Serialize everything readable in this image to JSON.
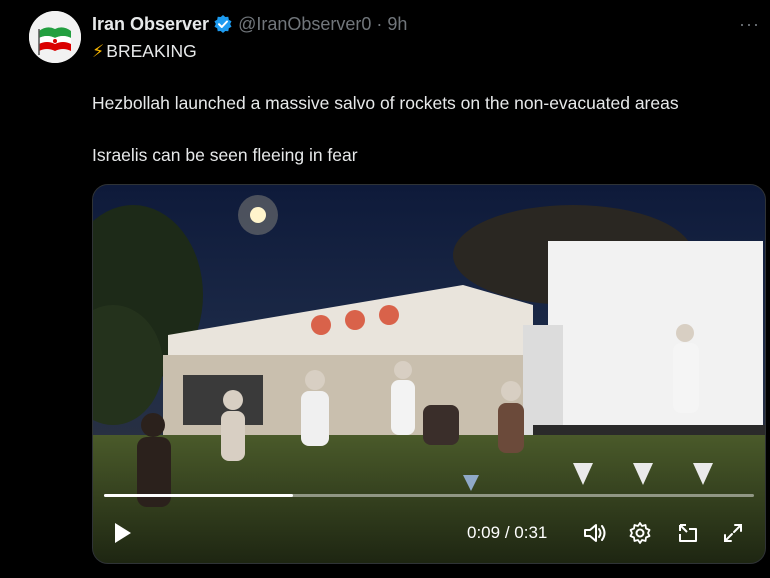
{
  "tweet": {
    "display_name": "Iran Observer",
    "handle": "@IranObserver0",
    "separator": "·",
    "time": "9h",
    "more": "···",
    "breaking": "BREAKING",
    "line1": "Hezbollah launched a massive salvo of rockets on the non-evacuated areas",
    "line2": "Israelis can be seen fleeing in fear"
  },
  "video": {
    "current_time": "0:09",
    "duration": "0:31",
    "time_separator": " / ",
    "progress": 0.29
  },
  "icons": {
    "verified": "verified-badge-icon",
    "bolt": "lightning-icon",
    "play": "play-icon",
    "volume": "volume-icon",
    "settings": "gear-icon",
    "pip": "picture-in-picture-icon",
    "fullscreen": "fullscreen-icon"
  },
  "colors": {
    "background": "#000000",
    "text": "#e7e9ea",
    "muted": "#71767b",
    "verified": "#1d9bf0"
  }
}
